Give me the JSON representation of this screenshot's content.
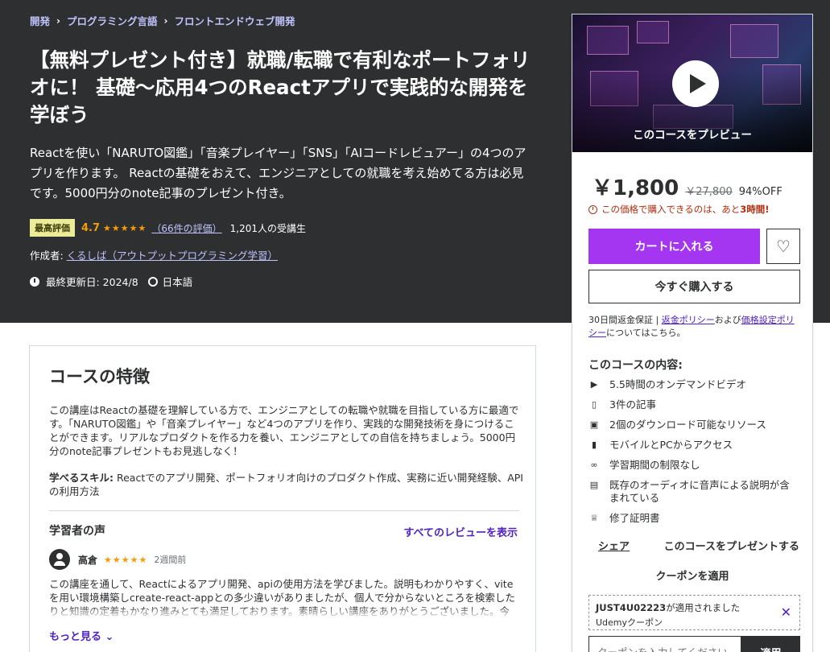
{
  "breadcrumb": [
    "開発",
    "プログラミング言語",
    "フロントエンドウェブ開発"
  ],
  "course": {
    "title": "【無料プレゼント付き】就職/転職で有利なポートフォリオに！ 基礎～応用4つのReactアプリで実践的な開発を学ぼう",
    "subtitle": "Reactを使い「NARUTO図鑑」「音楽プレイヤー」「SNS」「AIコードレビュアー」の4つのアプリを作ります。 Reactの基礎をおえて、エンジニアとしての就職を考え始めてる方は必見です。5000円分のnote記事のプレゼント付き。",
    "badge": "最高評価",
    "rating": "4.7",
    "stars": "★★★★★",
    "reviews_link": "（66件の評価）",
    "students": "1,201人の受講生",
    "author_label": "作成者:",
    "author": "くるしば（アウトプットプログラミング学習）",
    "updated": "最終更新日: 2024/8",
    "language": "日本語"
  },
  "features": {
    "heading": "コースの特徴",
    "description": "この講座はReactの基礎を理解している方で、エンジニアとしての転職や就職を目指している方に最適です。「NARUTO図鑑」や「音楽プレイヤー」など4つのアプリを作り、実践的な開発技術を身につけることができます。リアルなプロダクトを作る力を養い、エンジニアとしての自信を持ちましょう。5000円分のnote記事プレゼントもお見逃しなく！",
    "skills_label": "学べるスキル:",
    "skills": " Reactでのアプリ開発、ポートフォリオ向けのプロダクト作成、実務に近い開発経験、APIの利用方法",
    "voice_heading": "学習者の声",
    "all_reviews": "すべてのレビューを表示",
    "review": {
      "name": "高倉",
      "stars": "★★★★★",
      "date": "2週間前",
      "text": "この講座を通して、Reactによるアプリ開発、apiの使用方法を学びました。説明もわかりやすく、viteを用い環境構築しcreate-react-appとの多少違いがありましたが、個人で分からないところを検索したりと知識の定着もかなり進みとても満足しております。素晴らしい講座をありがとうございました。今"
    },
    "more": "もっと見る"
  },
  "sidebar": {
    "preview_label": "このコースをプレビュー",
    "price": "￥1,800",
    "original_price": "￥27,800",
    "discount": "94%OFF",
    "timer_prefix": "この価格で購入できるのは、あと",
    "timer_value": "3時間!",
    "cart_button": "カートに入れる",
    "buy_button": "今すぐ購入する",
    "guarantee_prefix": "30日間返金保証 | ",
    "refund_policy": "返金ポリシー",
    "guarantee_and": "および",
    "pricing_policy": "価格設定ポリシー",
    "guarantee_suffix": "についてはこちら。",
    "includes_heading": "このコースの内容:",
    "includes": [
      {
        "icon": "video-icon",
        "text": "5.5時間のオンデマンドビデオ"
      },
      {
        "icon": "article-icon",
        "text": "3件の記事"
      },
      {
        "icon": "download-folder-icon",
        "text": "2個のダウンロード可能なリソース"
      },
      {
        "icon": "mobile-icon",
        "text": "モバイルとPCからアクセス"
      },
      {
        "icon": "infinity-icon",
        "text": "学習期間の制限なし"
      },
      {
        "icon": "audio-description-icon",
        "text": "既存のオーディオに音声による説明が含まれている"
      },
      {
        "icon": "trophy-icon",
        "text": "修了証明書"
      }
    ],
    "share": "シェア",
    "gift": "このコースをプレゼントする",
    "coupon_apply": "クーポンを適用",
    "coupon_code": "JUST4U02223",
    "coupon_applied": "が適用されました",
    "coupon_type": "Udemyクーポン",
    "coupon_placeholder": "クーポンを入力してください",
    "apply_button": "適用"
  },
  "colors": {
    "hero_bg": "#2d2f31",
    "accent_purple": "#a435f0",
    "link_purple": "#5022c3",
    "star_orange": "#f69c08",
    "warning_red": "#b32d0f"
  }
}
